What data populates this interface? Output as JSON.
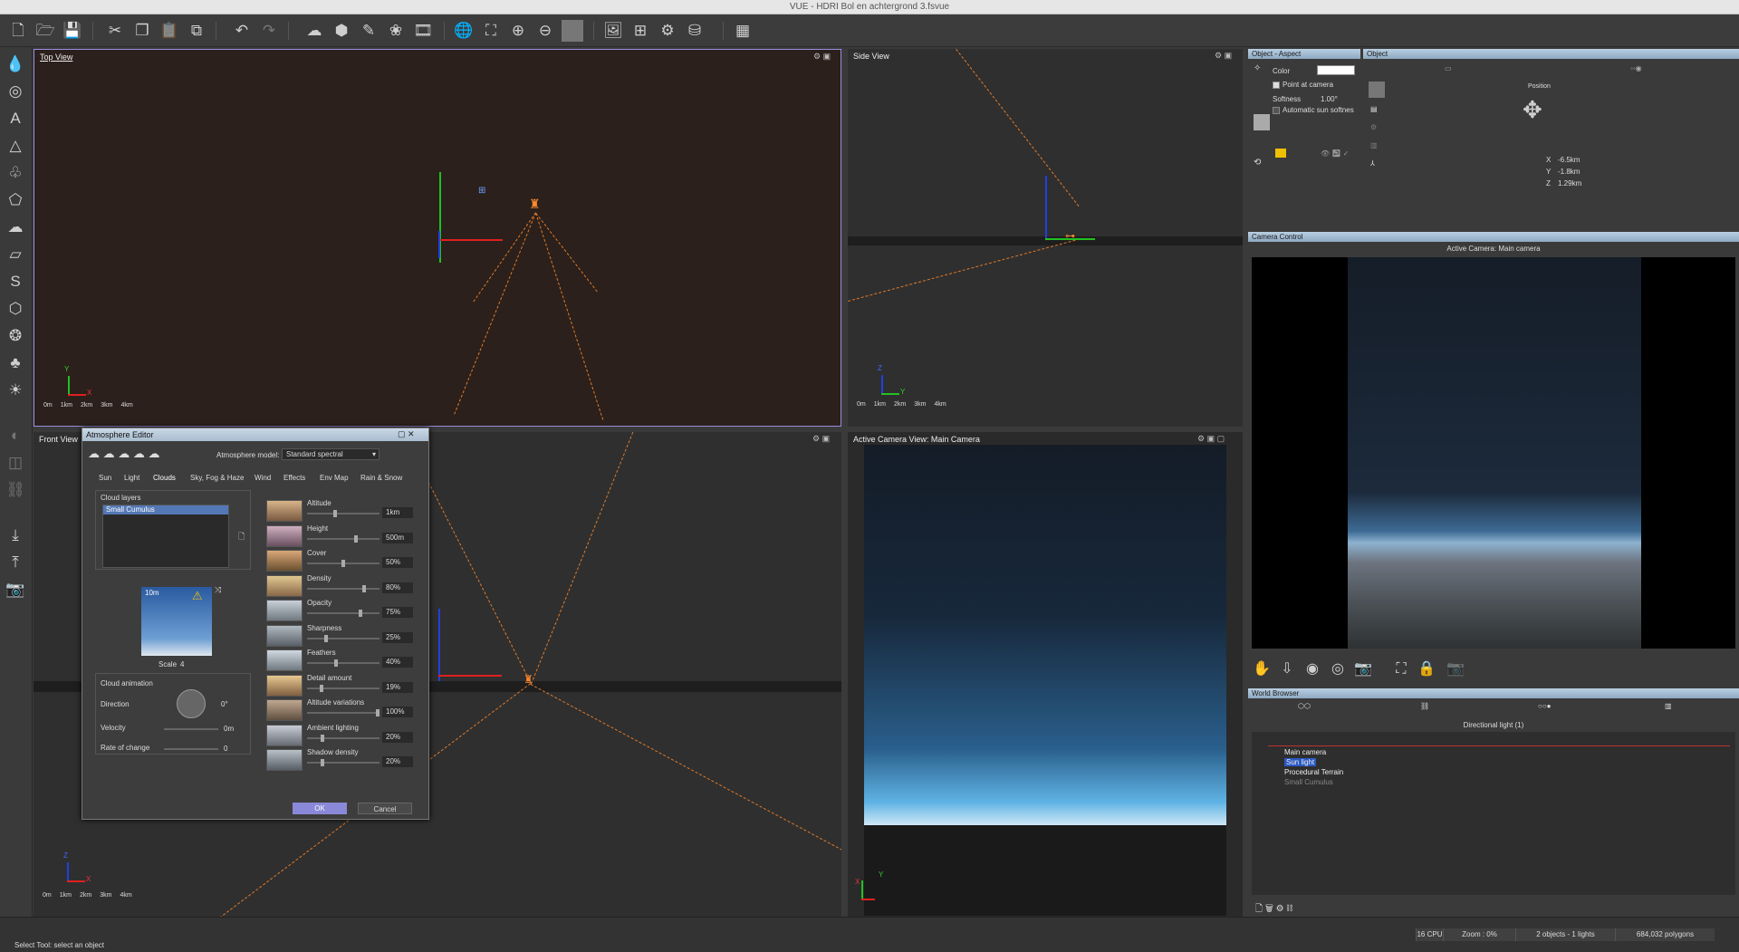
{
  "window": {
    "title": "VUE - HDRI Bol en achtergrond 3.fsvue"
  },
  "toolbar": {
    "icons": [
      "new-file-icon",
      "open-file-icon",
      "save-file-icon",
      "cut-icon",
      "copy-icon",
      "paste-icon",
      "duplicate-icon",
      "undo-icon",
      "redo-icon",
      "atmosphere-icon",
      "material-icon",
      "paint-icon",
      "ecosystem-icon",
      "film-icon",
      "globe-icon",
      "fit-view-icon",
      "zoom-in-icon",
      "zoom-out-icon",
      "preview-icon",
      "render-icon",
      "render-area-icon",
      "npr-icon",
      "render-media-icon",
      "layout-icon"
    ]
  },
  "views": {
    "top": {
      "label": "Top View"
    },
    "side": {
      "label": "Side View"
    },
    "front": {
      "label": "Front View"
    },
    "camera": {
      "label": "Active Camera View: Main Camera"
    },
    "scale_labels": [
      "0m",
      "1km",
      "2km",
      "3km",
      "4km"
    ],
    "axis_labels": {
      "x": "X",
      "y": "Y",
      "z": "Z"
    }
  },
  "aspect_panel": {
    "title": "Object - Aspect",
    "color_label": "Color",
    "point_at_camera": "Point at camera",
    "softness_label": "Softness",
    "softness_value": "1.00°",
    "auto_softness": "Automatic sun softnes"
  },
  "object_panel": {
    "title": "Object",
    "position_label": "Position",
    "x_label": "X",
    "x_value": "-6.5km",
    "y_label": "Y",
    "y_value": "-1.8km",
    "z_label": "Z",
    "z_value": "1.29km"
  },
  "camera_control": {
    "title": "Camera Control",
    "active_camera": "Active Camera: Main camera"
  },
  "world_browser": {
    "title": "World Browser",
    "subtitle": "Directional light (1)",
    "items": [
      "Main camera",
      "Sun light",
      "Procedural Terrain",
      "Small Cumulus"
    ]
  },
  "atmosphere_editor": {
    "title": "Atmosphere Editor",
    "model_label": "Atmosphere model:",
    "model_value": "Standard spectral",
    "tabs": [
      "Sun",
      "Light",
      "Clouds",
      "Sky, Fog & Haze",
      "Wind",
      "Effects",
      "Env Map",
      "Rain & Snow"
    ],
    "cloud_layers_label": "Cloud layers",
    "cloud_layer_selected": "Small Cumulus",
    "preview_size": "10m",
    "scale_label": "Scale",
    "scale_value": "4",
    "cloud_animation_label": "Cloud animation",
    "direction_label": "Direction",
    "direction_value": "0°",
    "velocity_label": "Velocity",
    "velocity_value": "0m",
    "rate_label": "Rate of change",
    "rate_value": "0",
    "sliders": [
      {
        "name": "Altitude",
        "value": "1km",
        "pos": 0.38
      },
      {
        "name": "Height",
        "value": "500m",
        "pos": 0.68
      },
      {
        "name": "Cover",
        "value": "50%",
        "pos": 0.5
      },
      {
        "name": "Density",
        "value": "80%",
        "pos": 0.8
      },
      {
        "name": "Opacity",
        "value": "75%",
        "pos": 0.75
      },
      {
        "name": "Sharpness",
        "value": "25%",
        "pos": 0.25
      },
      {
        "name": "Feathers",
        "value": "40%",
        "pos": 0.4
      },
      {
        "name": "Detail amount",
        "value": "19%",
        "pos": 0.19
      },
      {
        "name": "Altitude variations",
        "value": "100%",
        "pos": 1.0
      },
      {
        "name": "Ambient lighting",
        "value": "20%",
        "pos": 0.2
      },
      {
        "name": "Shadow density",
        "value": "20%",
        "pos": 0.2
      }
    ],
    "ok_label": "OK",
    "cancel_label": "Cancel"
  },
  "status": {
    "hint": "Select Tool: select an object",
    "cpu": "16 CPU",
    "zoom": "Zoom : 0%",
    "objects": "2 objects - 1 lights",
    "polygons": "684,032 polygons"
  }
}
